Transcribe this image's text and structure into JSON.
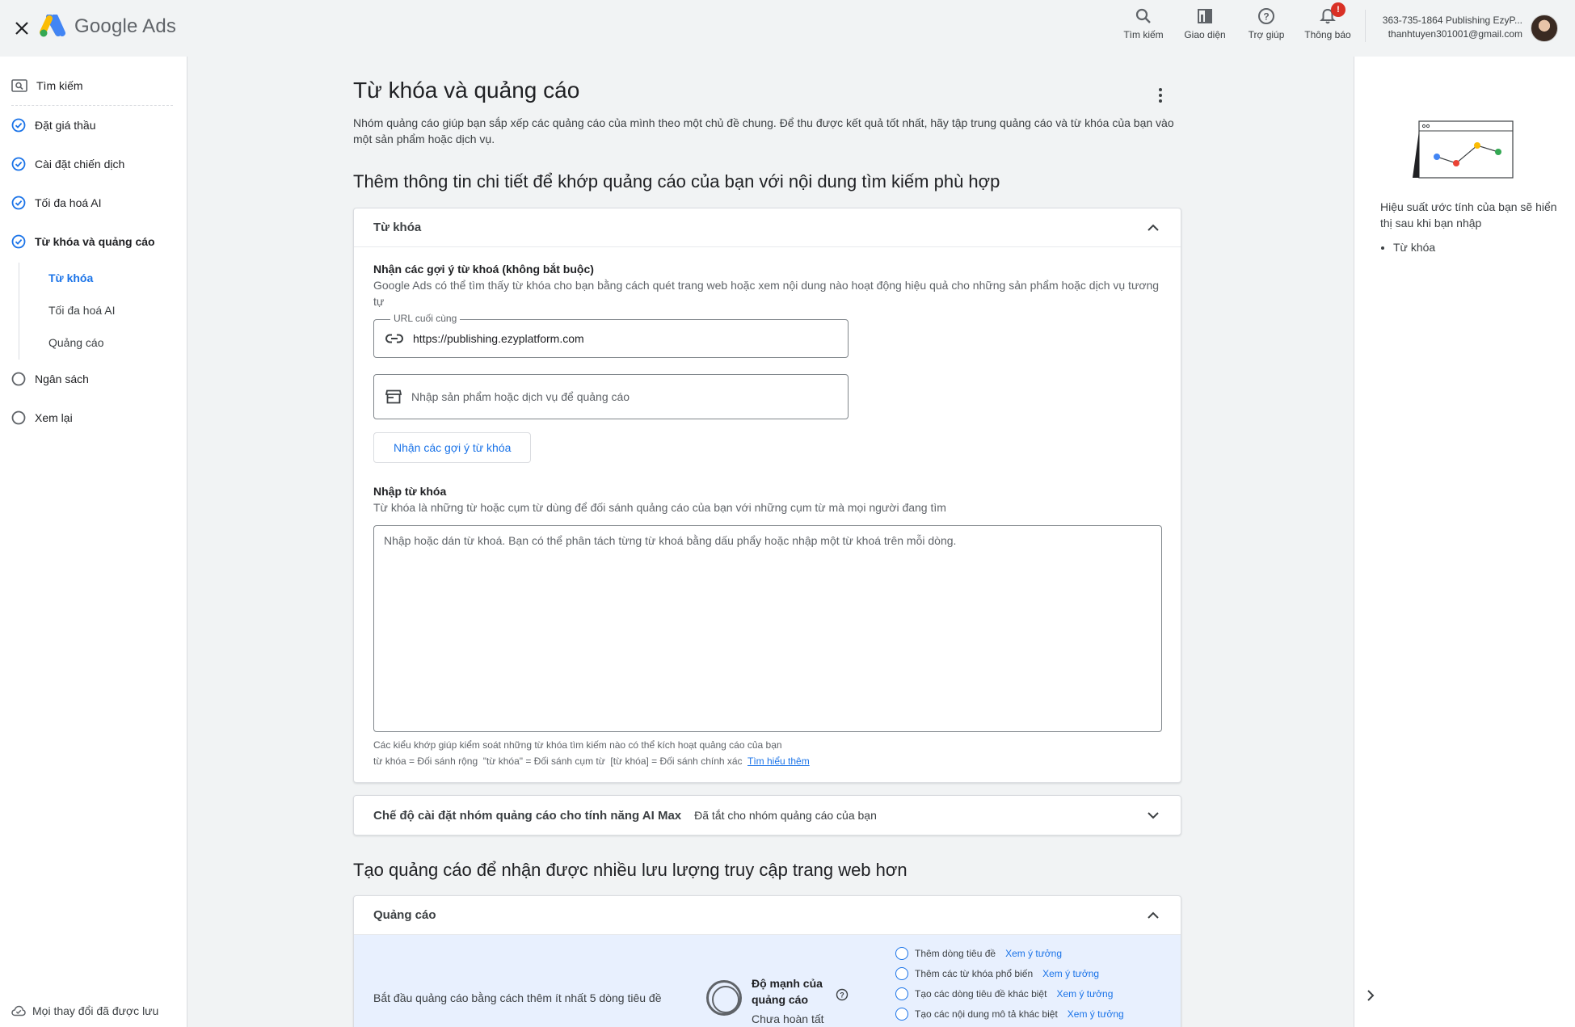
{
  "app": {
    "brand": "Google Ads",
    "top_actions": [
      {
        "label": "Tìm kiếm",
        "icon": "search-icon"
      },
      {
        "label": "Giao diện",
        "icon": "appearance-icon"
      },
      {
        "label": "Trợ giúp",
        "icon": "help-icon"
      },
      {
        "label": "Thông báo",
        "icon": "bell-icon",
        "badge": "!"
      }
    ],
    "account": {
      "line1": "363-735-1864 Publishing EzyP...",
      "line2": "thanhtuyen301001@gmail.com"
    }
  },
  "sidebar": {
    "search_label": "Tìm kiếm",
    "steps": [
      {
        "label": "Đặt giá thầu",
        "status": "done"
      },
      {
        "label": "Cài đặt chiến dịch",
        "status": "done"
      },
      {
        "label": "Tối đa hoá AI",
        "status": "done"
      },
      {
        "label": "Từ khóa và quảng cáo",
        "status": "current"
      }
    ],
    "substeps": [
      {
        "label": "Từ khóa",
        "active": true
      },
      {
        "label": "Tối đa hoá AI",
        "active": false
      },
      {
        "label": "Quảng cáo",
        "active": false
      }
    ],
    "later_steps": [
      {
        "label": "Ngân sách",
        "status": "todo"
      },
      {
        "label": "Xem lại",
        "status": "todo"
      }
    ],
    "saved_status": "Mọi thay đổi đã được lưu"
  },
  "main": {
    "title": "Từ khóa và quảng cáo",
    "description": "Nhóm quảng cáo giúp bạn sắp xếp các quảng cáo của mình theo một chủ đề chung. Để thu được kết quả tốt nhất, hãy tập trung quảng cáo và từ khóa của bạn vào một sản phẩm hoặc dịch vụ.",
    "section1_title": "Thêm thông tin chi tiết để khớp quảng cáo của bạn với nội dung tìm kiếm phù hợp",
    "keywords_card": {
      "title": "Từ khóa",
      "suggest_heading": "Nhận các gợi ý từ khoá (không bắt buộc)",
      "suggest_desc": "Google Ads có thể tìm thấy từ khóa cho bạn bằng cách quét trang web hoặc xem nội dung nào hoạt động hiệu quả cho những sản phẩm hoặc dịch vụ tương tự",
      "url_legend": "URL cuối cùng",
      "url_value": "https://publishing.ezyplatform.com",
      "product_placeholder": "Nhập sản phẩm hoặc dịch vụ để quảng cáo",
      "suggest_button": "Nhận các gợi ý từ khóa",
      "enter_heading": "Nhập từ khóa",
      "enter_desc": "Từ khóa là những từ hoặc cụm từ dùng để đối sánh quảng cáo của bạn với những cụm từ mà mọi người đang tìm",
      "textarea_placeholder": "Nhập hoặc dán từ khoá. Bạn có thể phân tách từng từ khoá bằng dấu phẩy hoặc nhập một từ khoá trên mỗi dòng.",
      "match_hint": "Các kiểu khớp giúp kiểm soát những từ khóa tìm kiếm nào có thể kích hoạt quảng cáo của bạn",
      "match_types": "từ khóa = Đối sánh rộng  \"từ khóa\" = Đối sánh cụm từ  [từ khóa] = Đối sánh chính xác",
      "learn_more": "Tìm hiểu thêm"
    },
    "ai_max_card": {
      "title": "Chế độ cài đặt nhóm quảng cáo cho tính năng AI Max",
      "status": "Đã tắt cho nhóm quảng cáo của bạn"
    },
    "section2_title": "Tạo quảng cáo để nhận được nhiều lưu lượng truy cập trang web hơn",
    "ads_card": {
      "title": "Quảng cáo",
      "start_text": "Bắt đầu quảng cáo bằng cách thêm ít nhất 5 dòng tiêu đề",
      "strength_title": "Độ mạnh của quảng cáo",
      "strength_status": "Chưa hoàn tất",
      "ideas": [
        {
          "text": "Thêm dòng tiêu đề",
          "link": "Xem ý tưởng"
        },
        {
          "text": "Thêm các từ khóa phổ biến",
          "link": "Xem ý tưởng"
        },
        {
          "text": "Tạo các dòng tiêu đề khác biệt",
          "link": "Xem ý tưởng"
        },
        {
          "text": "Tạo các nội dung mô tả khác biệt",
          "link": "Xem ý tưởng"
        }
      ]
    }
  },
  "right_panel": {
    "text": "Hiệu suất ước tính của bạn sẽ hiển thị sau khi bạn nhập",
    "items": [
      "Từ khóa"
    ]
  },
  "colors": {
    "accent": "#1a73e8",
    "badge": "#d93025",
    "ads_body_bg": "#e8f0fe"
  }
}
